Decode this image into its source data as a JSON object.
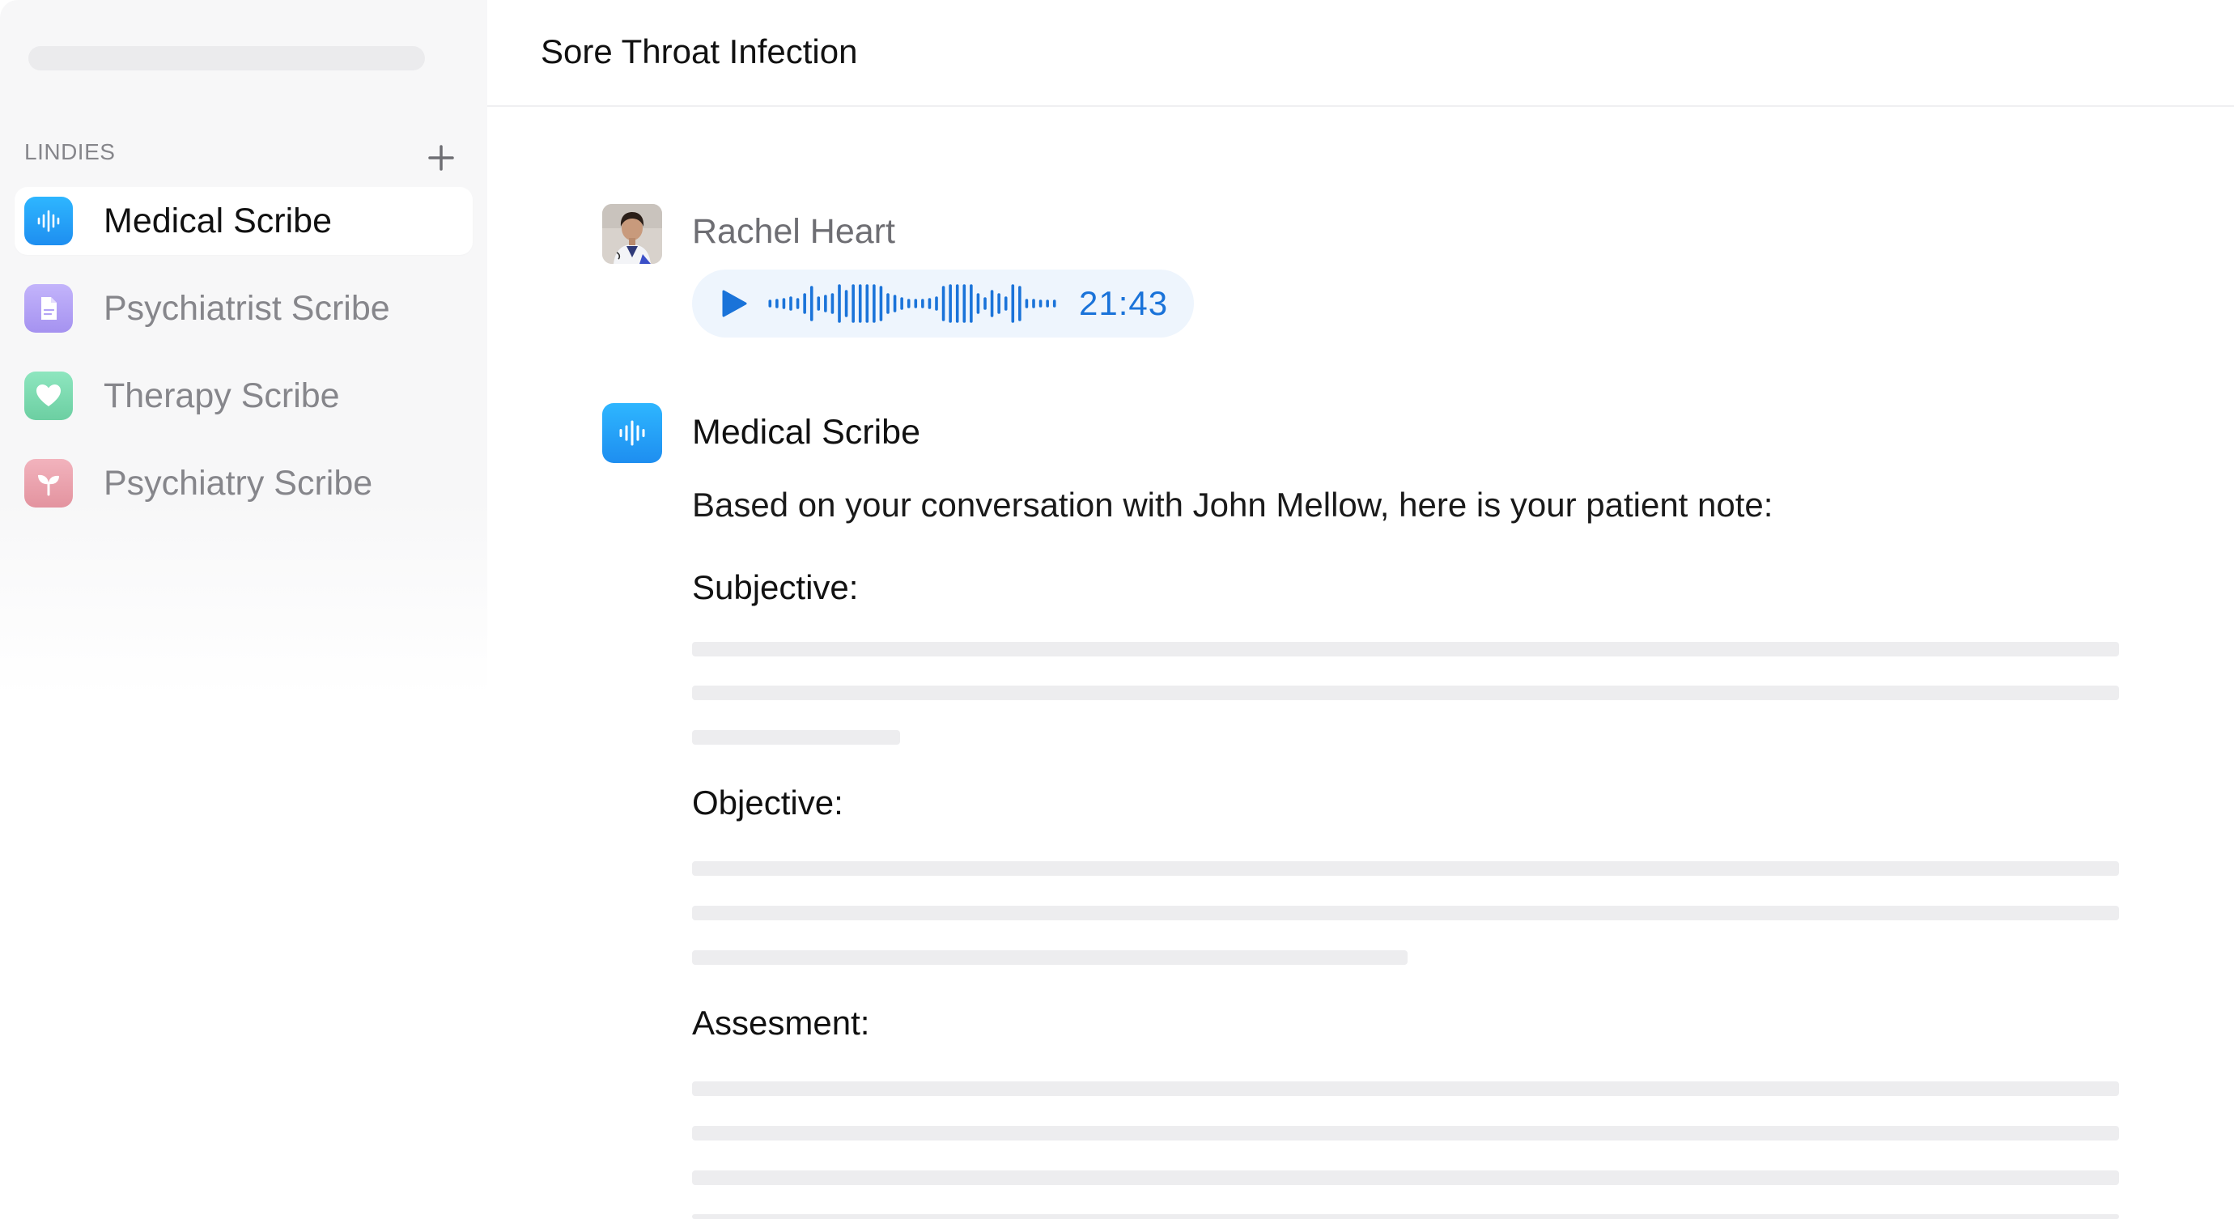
{
  "sidebar": {
    "section_label": "LINDIES",
    "items": [
      {
        "label": "Medical Scribe",
        "icon": "waveform-icon",
        "color": "#2aa8f8",
        "active": true
      },
      {
        "label": "Psychiatrist Scribe",
        "icon": "document-icon",
        "color": "#b3a3f5",
        "active": false
      },
      {
        "label": "Therapy Scribe",
        "icon": "heart-icon",
        "color": "#7ddab0",
        "active": false
      },
      {
        "label": "Psychiatry Scribe",
        "icon": "sprout-icon",
        "color": "#eaa5b0",
        "active": false
      }
    ]
  },
  "header": {
    "title": "Sore Throat Infection"
  },
  "conversation": {
    "user_message": {
      "sender": "Rachel Heart",
      "audio_duration": "21:43"
    },
    "scribe_message": {
      "sender": "Medical Scribe",
      "intro": "Based on your conversation with John Mellow, here is your patient note:",
      "sections": [
        {
          "heading": "Subjective:"
        },
        {
          "heading": "Objective:"
        },
        {
          "heading": "Assesment:"
        }
      ]
    }
  },
  "colors": {
    "accent": "#1a73d9",
    "audio_bg": "#eef5fd",
    "skeleton": "#ededef"
  }
}
